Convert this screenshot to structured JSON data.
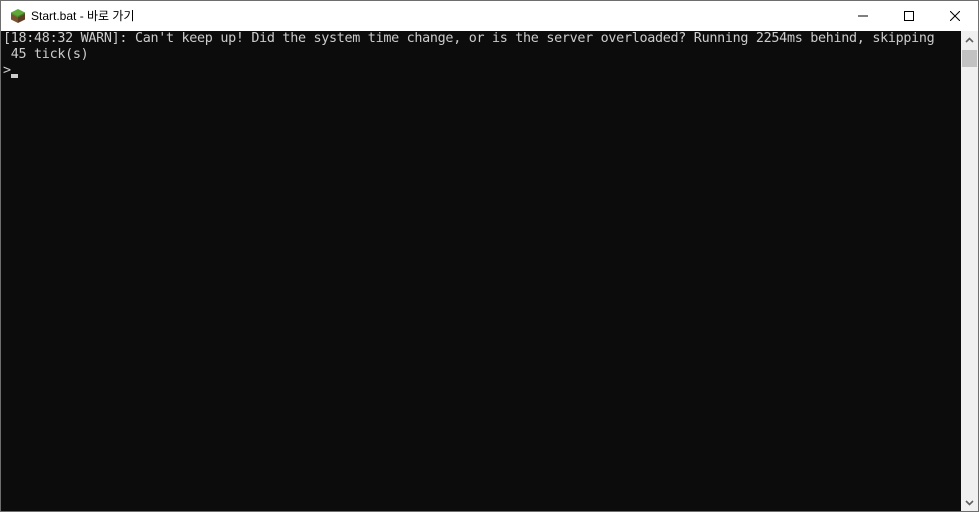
{
  "window": {
    "title": "Start.bat - 바로 가기",
    "app_icon": "minecraft-grass-block-icon",
    "controls": {
      "minimize": "minimize-icon",
      "maximize": "maximize-icon",
      "close": "close-icon"
    }
  },
  "console": {
    "lines": [
      "[18:48:32 WARN]: Can't keep up! Did the system time change, or is the server overloaded? Running 2254ms behind, skipping",
      " 45 tick(s)"
    ],
    "prompt": ">",
    "colors": {
      "background": "#0c0c0c",
      "text": "#cccccc"
    }
  },
  "scrollbar": {
    "up_icon": "chevron-up-icon",
    "down_icon": "chevron-down-icon"
  }
}
